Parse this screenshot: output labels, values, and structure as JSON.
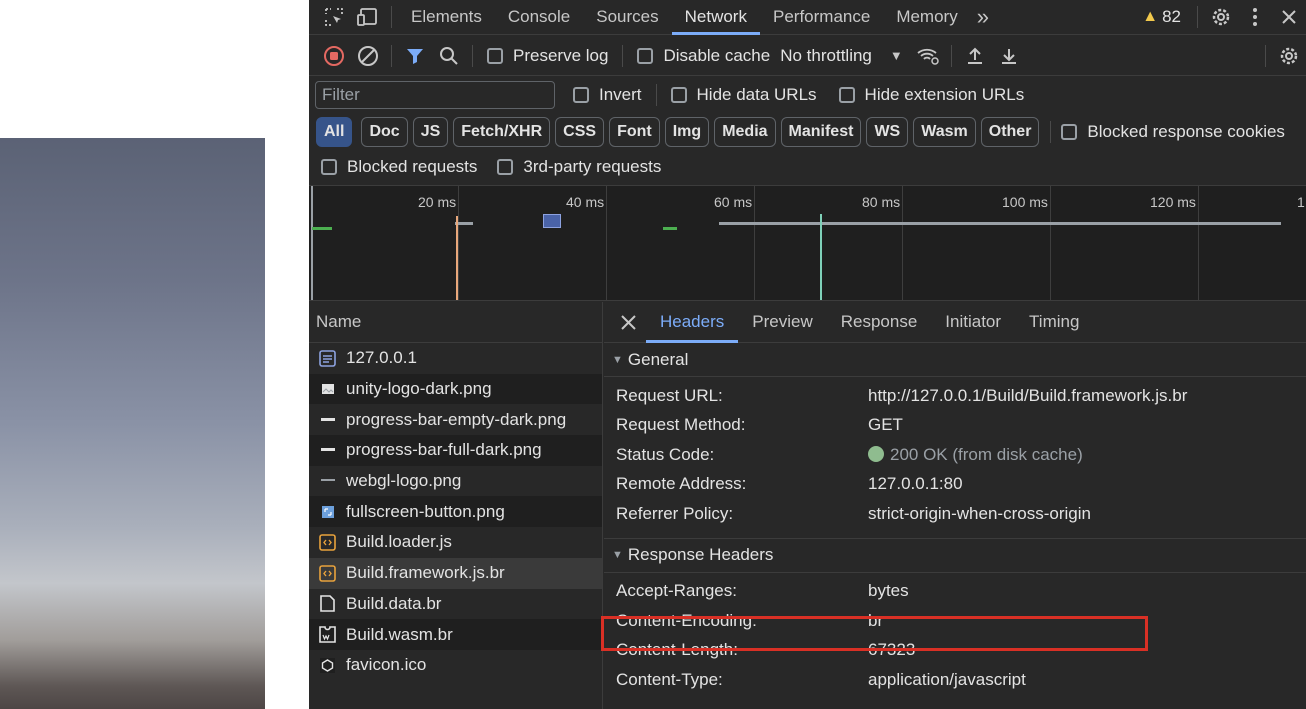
{
  "devtools": {
    "main_tabs": [
      "Elements",
      "Console",
      "Sources",
      "Network",
      "Performance",
      "Memory"
    ],
    "active_tab": "Network",
    "more_tabs": "»",
    "warning_count": "82"
  },
  "toolbar": {
    "preserve_log": "Preserve log",
    "disable_cache": "Disable cache",
    "throttling": "No throttling"
  },
  "filter": {
    "placeholder": "Filter",
    "invert": "Invert",
    "hide_data_urls": "Hide data URLs",
    "hide_extension_urls": "Hide extension URLs"
  },
  "types": [
    "All",
    "Doc",
    "JS",
    "Fetch/XHR",
    "CSS",
    "Font",
    "Img",
    "Media",
    "Manifest",
    "WS",
    "Wasm",
    "Other"
  ],
  "blocked_response_cookies": "Blocked response cookies",
  "blocked_requests": "Blocked requests",
  "third_party_requests": "3rd-party requests",
  "timeline": {
    "ticks": [
      "20 ms",
      "40 ms",
      "60 ms",
      "80 ms",
      "100 ms",
      "120 ms",
      "1"
    ]
  },
  "names": {
    "header": "Name",
    "rows": [
      {
        "name": "127.0.0.1",
        "icon": "document-icon"
      },
      {
        "name": "unity-logo-dark.png",
        "icon": "image-icon"
      },
      {
        "name": "progress-bar-empty-dark.png",
        "icon": "image-icon"
      },
      {
        "name": "progress-bar-full-dark.png",
        "icon": "image-icon"
      },
      {
        "name": "webgl-logo.png",
        "icon": "image-icon"
      },
      {
        "name": "fullscreen-button.png",
        "icon": "image-icon"
      },
      {
        "name": "Build.loader.js",
        "icon": "script-icon"
      },
      {
        "name": "Build.framework.js.br",
        "icon": "script-icon"
      },
      {
        "name": "Build.data.br",
        "icon": "file-icon"
      },
      {
        "name": "Build.wasm.br",
        "icon": "wasm-icon"
      },
      {
        "name": "favicon.ico",
        "icon": "favicon-icon"
      }
    ]
  },
  "details": {
    "tabs": [
      "Headers",
      "Preview",
      "Response",
      "Initiator",
      "Timing"
    ],
    "active": "Headers",
    "general": {
      "title": "General",
      "rows": [
        {
          "key": "Request URL:",
          "value": "http://127.0.0.1/Build/Build.framework.js.br"
        },
        {
          "key": "Request Method:",
          "value": "GET"
        },
        {
          "key": "Status Code:",
          "value": "200 OK (from disk cache)"
        },
        {
          "key": "Remote Address:",
          "value": "127.0.0.1:80"
        },
        {
          "key": "Referrer Policy:",
          "value": "strict-origin-when-cross-origin"
        }
      ]
    },
    "response": {
      "title": "Response Headers",
      "rows": [
        {
          "key": "Accept-Ranges:",
          "value": "bytes"
        },
        {
          "key": "Content-Encoding:",
          "value": "br"
        },
        {
          "key": "Content-Length:",
          "value": "67323"
        },
        {
          "key": "Content-Type:",
          "value": "application/javascript"
        }
      ]
    }
  },
  "colors": {
    "accent": "#7cacf8",
    "highlight": "#d93025",
    "status_ok": "#8fbc8f",
    "warning": "#f2c94c",
    "record": "#e46962"
  }
}
